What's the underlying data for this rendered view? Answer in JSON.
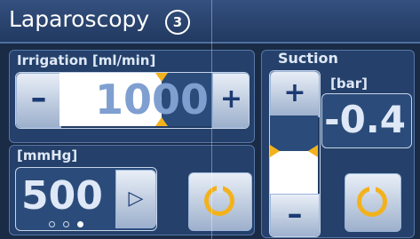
{
  "header": {
    "title": "Laparoscopy",
    "step_badge": "3"
  },
  "irrigation": {
    "label": "Irrigation [ml/min]",
    "value": "1000",
    "decrease_label": "–",
    "increase_label": "+",
    "level_fraction": 0.67
  },
  "pressure": {
    "label": "[mmHg]",
    "value": "500",
    "play_label": "▷",
    "pages": [
      false,
      false,
      true
    ]
  },
  "suction": {
    "label": "Suction",
    "unit": "[bar]",
    "value": "-0.4",
    "increase_label": "+",
    "decrease_label": "–",
    "level_fraction": 0.55
  },
  "colors": {
    "accent": "#f3b21b",
    "background": "#1a2b45",
    "button": "#c3d1e6"
  },
  "icons": [
    "circular-arrow-icon",
    "play-icon",
    "triangle-marker-icon"
  ]
}
